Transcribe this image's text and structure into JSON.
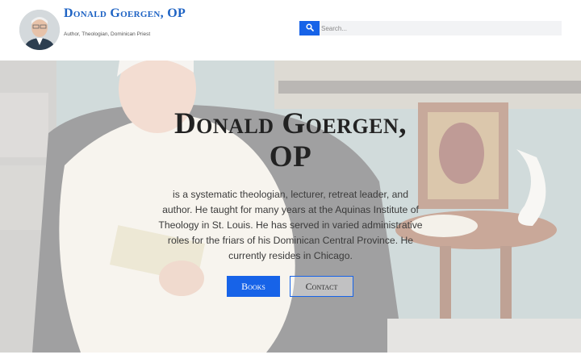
{
  "site": {
    "title": "Donald Goergen, OP",
    "tagline": "Author, Theologian, Dominican Priest"
  },
  "search": {
    "placeholder": "Search...",
    "value": "",
    "icon": "search-icon"
  },
  "hero": {
    "title": "Donald Goergen, OP",
    "text": "is a systematic theologian, lecturer, retreat leader, and author. He taught for many years at the Aquinas Institute of Theology in St. Louis. He has served in varied administrative roles for the friars of his Dominican Central Province. He currently resides in Chicago.",
    "buttons": {
      "books": "Books",
      "contact": "Contact"
    }
  },
  "colors": {
    "accent": "#1763e8",
    "title": "#1e63c4",
    "heading": "#222222"
  }
}
